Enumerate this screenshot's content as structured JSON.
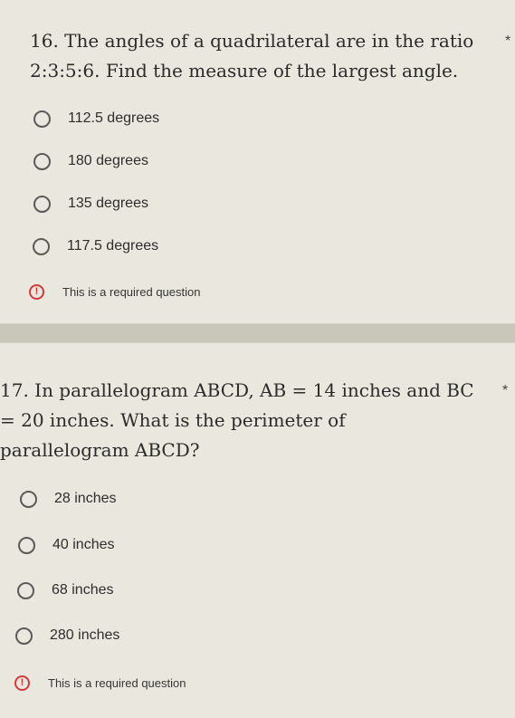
{
  "questions": [
    {
      "title": "16. The angles of a quadrilateral are in the ratio 2:3:5:6. Find the measure of the largest angle.",
      "required_marker": "*",
      "options": [
        "112.5 degrees",
        "180 degrees",
        "135 degrees",
        "117.5 degrees"
      ],
      "required_message": "This is a required question"
    },
    {
      "title": "17. In parallelogram ABCD, AB = 14 inches and BC = 20 inches. What is the perimeter of parallelogram ABCD?",
      "required_marker": "*",
      "options": [
        "28 inches",
        "40 inches",
        "68 inches",
        "280 inches"
      ],
      "required_message": "This is a required question"
    }
  ],
  "colors": {
    "card_background": "#e9e7de",
    "page_background": "#c9c7b9",
    "error_accent": "#d33b3b"
  },
  "icons": {
    "radio": "radio-unchecked-icon",
    "alert": "exclamation-circle-icon"
  }
}
